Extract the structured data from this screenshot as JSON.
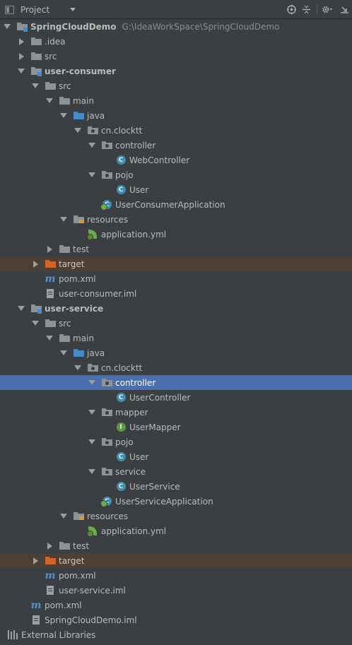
{
  "header": {
    "view_label": "Project",
    "tools": [
      "target-icon",
      "collapse-icon",
      "gear-icon",
      "hide-icon"
    ]
  },
  "tree": [
    {
      "label": "SpringCloudDemo",
      "hint": "G:\\IdeaWorkSpace\\SpringCloudDemo",
      "icon": "module-folder-icon",
      "arrow": "down",
      "depth": 0,
      "bold": true
    },
    {
      "label": ".idea",
      "icon": "folder-icon",
      "arrow": "right",
      "depth": 1
    },
    {
      "label": "src",
      "icon": "folder-icon",
      "arrow": "right",
      "depth": 1
    },
    {
      "label": "user-consumer",
      "icon": "module-folder-icon",
      "arrow": "down",
      "depth": 1,
      "bold": true
    },
    {
      "label": "src",
      "icon": "folder-icon",
      "arrow": "down",
      "depth": 2
    },
    {
      "label": "main",
      "icon": "folder-icon",
      "arrow": "down",
      "depth": 3
    },
    {
      "label": "java",
      "icon": "source-folder-icon",
      "arrow": "down",
      "depth": 4
    },
    {
      "label": "cn.clocktt",
      "icon": "package-icon",
      "arrow": "down",
      "depth": 5
    },
    {
      "label": "controller",
      "icon": "package-icon",
      "arrow": "down",
      "depth": 6
    },
    {
      "label": "WebController",
      "icon": "class-icon",
      "arrow": "none",
      "depth": 7
    },
    {
      "label": "pojo",
      "icon": "package-icon",
      "arrow": "down",
      "depth": 6
    },
    {
      "label": "User",
      "icon": "class-icon",
      "arrow": "none",
      "depth": 7
    },
    {
      "label": "UserConsumerApplication",
      "icon": "spring-boot-class-icon",
      "arrow": "none",
      "depth": 6
    },
    {
      "label": "resources",
      "icon": "resources-folder-icon",
      "arrow": "down",
      "depth": 4
    },
    {
      "label": "application.yml",
      "icon": "spring-yml-icon",
      "arrow": "none",
      "depth": 5
    },
    {
      "label": "test",
      "icon": "folder-icon",
      "arrow": "right",
      "depth": 3
    },
    {
      "label": "target",
      "icon": "excluded-folder-icon",
      "arrow": "right",
      "depth": 2,
      "excluded": true
    },
    {
      "label": "pom.xml",
      "icon": "maven-icon",
      "arrow": "none",
      "depth": 2
    },
    {
      "label": "user-consumer.iml",
      "icon": "iml-file-icon",
      "arrow": "none",
      "depth": 2
    },
    {
      "label": "user-service",
      "icon": "module-folder-icon",
      "arrow": "down",
      "depth": 1,
      "bold": true
    },
    {
      "label": "src",
      "icon": "folder-icon",
      "arrow": "down",
      "depth": 2
    },
    {
      "label": "main",
      "icon": "folder-icon",
      "arrow": "down",
      "depth": 3
    },
    {
      "label": "java",
      "icon": "source-folder-icon",
      "arrow": "down",
      "depth": 4
    },
    {
      "label": "cn.clocktt",
      "icon": "package-icon",
      "arrow": "down",
      "depth": 5
    },
    {
      "label": "controller",
      "icon": "package-icon",
      "arrow": "down",
      "depth": 6,
      "selected": true
    },
    {
      "label": "UserController",
      "icon": "class-icon",
      "arrow": "none",
      "depth": 7
    },
    {
      "label": "mapper",
      "icon": "package-icon",
      "arrow": "down",
      "depth": 6
    },
    {
      "label": "UserMapper",
      "icon": "interface-icon",
      "arrow": "none",
      "depth": 7
    },
    {
      "label": "pojo",
      "icon": "package-icon",
      "arrow": "down",
      "depth": 6
    },
    {
      "label": "User",
      "icon": "class-icon",
      "arrow": "none",
      "depth": 7
    },
    {
      "label": "service",
      "icon": "package-icon",
      "arrow": "down",
      "depth": 6
    },
    {
      "label": "UserService",
      "icon": "class-icon",
      "arrow": "none",
      "depth": 7
    },
    {
      "label": "UserServiceApplication",
      "icon": "spring-boot-class-icon",
      "arrow": "none",
      "depth": 6
    },
    {
      "label": "resources",
      "icon": "resources-folder-icon",
      "arrow": "down",
      "depth": 4
    },
    {
      "label": "application.yml",
      "icon": "spring-yml-icon",
      "arrow": "none",
      "depth": 5
    },
    {
      "label": "test",
      "icon": "folder-icon",
      "arrow": "right",
      "depth": 3
    },
    {
      "label": "target",
      "icon": "excluded-folder-icon",
      "arrow": "right",
      "depth": 2,
      "excluded": true
    },
    {
      "label": "pom.xml",
      "icon": "maven-icon",
      "arrow": "none",
      "depth": 2
    },
    {
      "label": "user-service.iml",
      "icon": "iml-file-icon",
      "arrow": "none",
      "depth": 2
    },
    {
      "label": "pom.xml",
      "icon": "maven-icon",
      "arrow": "none",
      "depth": 1
    },
    {
      "label": "SpringCloudDemo.iml",
      "icon": "iml-file-icon",
      "arrow": "none",
      "depth": 1
    },
    {
      "label": "External Libraries",
      "icon": "libraries-icon",
      "arrow": "none",
      "depth": 0
    }
  ],
  "colors": {
    "background": "#3c3f41",
    "selection": "#4b6eaf",
    "excluded_row": "#4b3f36",
    "text": "#bbbbbb"
  }
}
